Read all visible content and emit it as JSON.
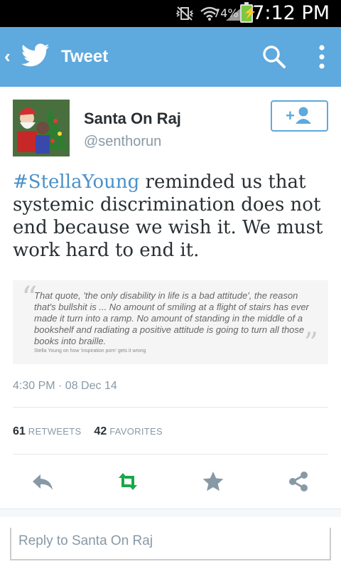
{
  "status_bar": {
    "battery_percent": "74%",
    "time": "7:12 PM"
  },
  "app_bar": {
    "title": "Tweet",
    "back_icon": "chevron-left-icon",
    "logo_icon": "twitter-bird-icon",
    "search_icon": "search-icon",
    "more_icon": "overflow-menu-icon"
  },
  "tweet": {
    "author_name": "Santa On Raj",
    "author_handle": "@senthorun",
    "hashtag": "#StellaYoung",
    "text_rest": " reminded us that systemic discrimination does not end because we wish it. We must work hard to end it.",
    "quote_card": {
      "text": "That quote, 'the only disability in life is a bad attitude', the reason that's bullshit is ... No amount of smiling at a flight of stairs has ever made it turn into a ramp. No amount of standing in the middle of a bookshelf and radiating a positive attitude is going to turn all those books into braille.",
      "source": "Stella Young on how 'inspiration porn' gets it wrong"
    },
    "timestamp": "4:30 PM · 08 Dec 14",
    "retweets_count": "61",
    "retweets_label": "RETWEETS",
    "favorites_count": "42",
    "favorites_label": "FAVORITES"
  },
  "actions": {
    "reply_icon": "reply-icon",
    "retweet_icon": "retweet-icon",
    "favorite_icon": "star-icon",
    "share_icon": "share-icon"
  },
  "reply": {
    "placeholder": "Reply to Santa On Raj"
  },
  "colors": {
    "brand": "#5ea9dd",
    "retweet_green": "#19a84a",
    "icon_gray": "#8899a6",
    "hashtag_blue": "#4a90c8"
  }
}
